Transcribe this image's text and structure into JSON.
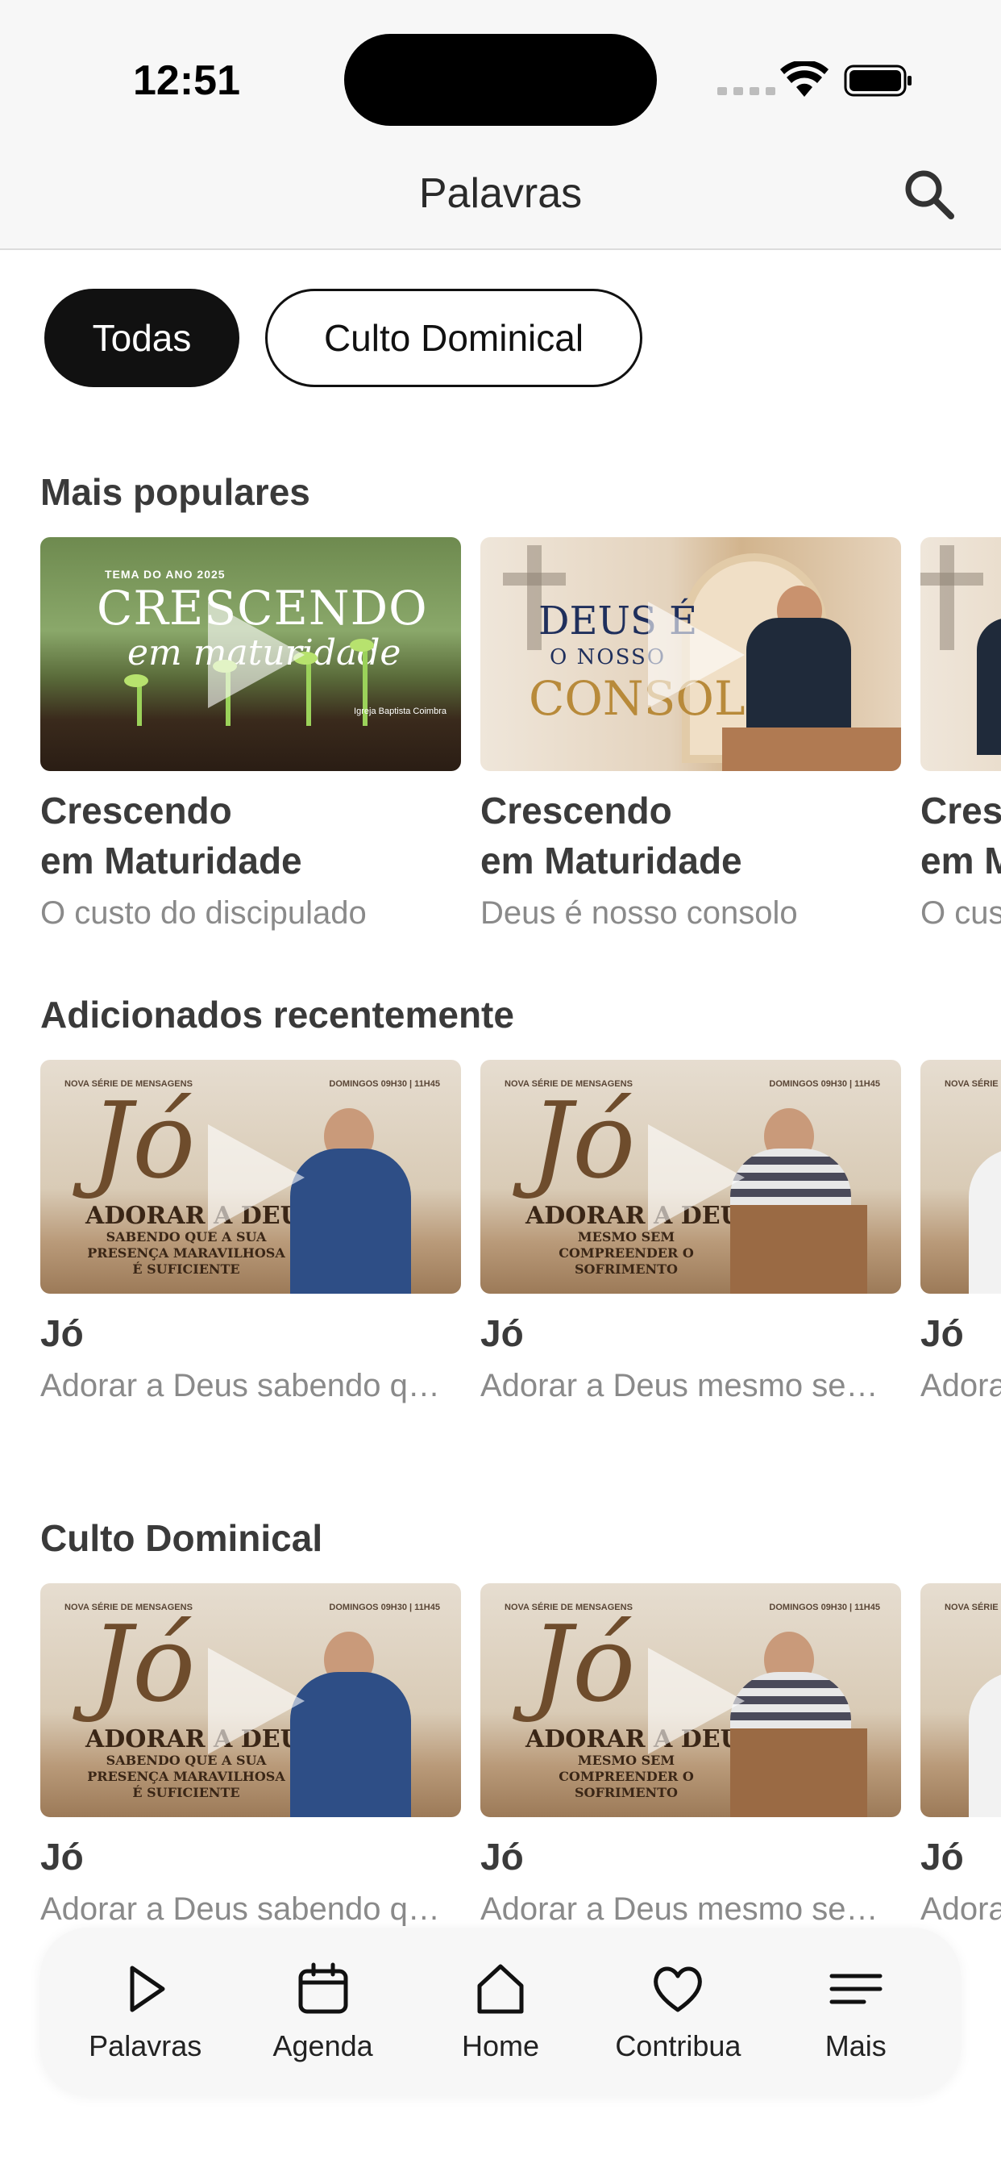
{
  "status_bar": {
    "time": "12:51"
  },
  "header": {
    "title": "Palavras"
  },
  "filters": [
    {
      "label": "Todas",
      "active": true
    },
    {
      "label": "Culto Dominical",
      "active": false
    }
  ],
  "sections": [
    {
      "title": "Mais populares",
      "cards": [
        {
          "title_line1": "Crescendo",
          "title_line2": "em Maturidade",
          "subtitle": "O custo do discipulado",
          "thumb_tag": "TEMA DO ANO 2025",
          "thumb_big": "CRESCENDO",
          "thumb_script": "em maturidade"
        },
        {
          "title_line1": "Crescendo",
          "title_line2": "em Maturidade",
          "subtitle": "Deus é nosso consolo",
          "thumb_deus": "DEUS É",
          "thumb_nosso": "O NOSSO",
          "thumb_consolo": "CONSOLO"
        },
        {
          "title_line1": "Cres",
          "title_line2": "em M",
          "subtitle": "O cus"
        }
      ]
    },
    {
      "title": "Adicionados recentemente",
      "cards": [
        {
          "title": "Jó",
          "subtitle": "Adorar a Deus sabendo que a sua presença maravilhosa é suficiente",
          "thumb_adorar": "ADORAR A DEUS",
          "thumb_line2": "SABENDO QUE A SUA PRESENÇA MARAVILHOSA É SUFICIENTE"
        },
        {
          "title": "Jó",
          "subtitle": "Adorar a Deus mesmo sem compreender o sofrimento",
          "thumb_adorar": "ADORAR A DEUS",
          "thumb_line2": "MESMO SEM COMPREENDER O SOFRIMENTO"
        },
        {
          "title": "Jó",
          "subtitle": "Adora"
        }
      ]
    },
    {
      "title": "Culto Dominical",
      "cards": [
        {
          "title": "Jó",
          "subtitle": "Adorar a Deus sabendo que a sua presença maravilhosa é suficiente",
          "thumb_adorar": "ADORAR A DEUS",
          "thumb_line2": "SABENDO QUE A SUA PRESENÇA MARAVILHOSA É SUFICIENTE"
        },
        {
          "title": "Jó",
          "subtitle": "Adorar a Deus mesmo sem compreender o sofrimento",
          "thumb_adorar": "ADORAR A DEUS",
          "thumb_line2": "MESMO SEM COMPREENDER O SOFRIMENTO"
        },
        {
          "title": "Jó",
          "subtitle": "Adora"
        }
      ]
    }
  ],
  "thumb_common": {
    "serie": "NOVA SÉRIE DE MENSAGENS",
    "domingos": "DOMINGOS 09H30 | 11H45",
    "jo_script": "Jó",
    "church": "Igreja Baptista Coimbra"
  },
  "tabbar": [
    {
      "label": "Palavras",
      "icon": "play-icon"
    },
    {
      "label": "Agenda",
      "icon": "calendar-icon"
    },
    {
      "label": "Home",
      "icon": "home-icon"
    },
    {
      "label": "Contribua",
      "icon": "heart-icon"
    },
    {
      "label": "Mais",
      "icon": "menu-icon"
    }
  ]
}
